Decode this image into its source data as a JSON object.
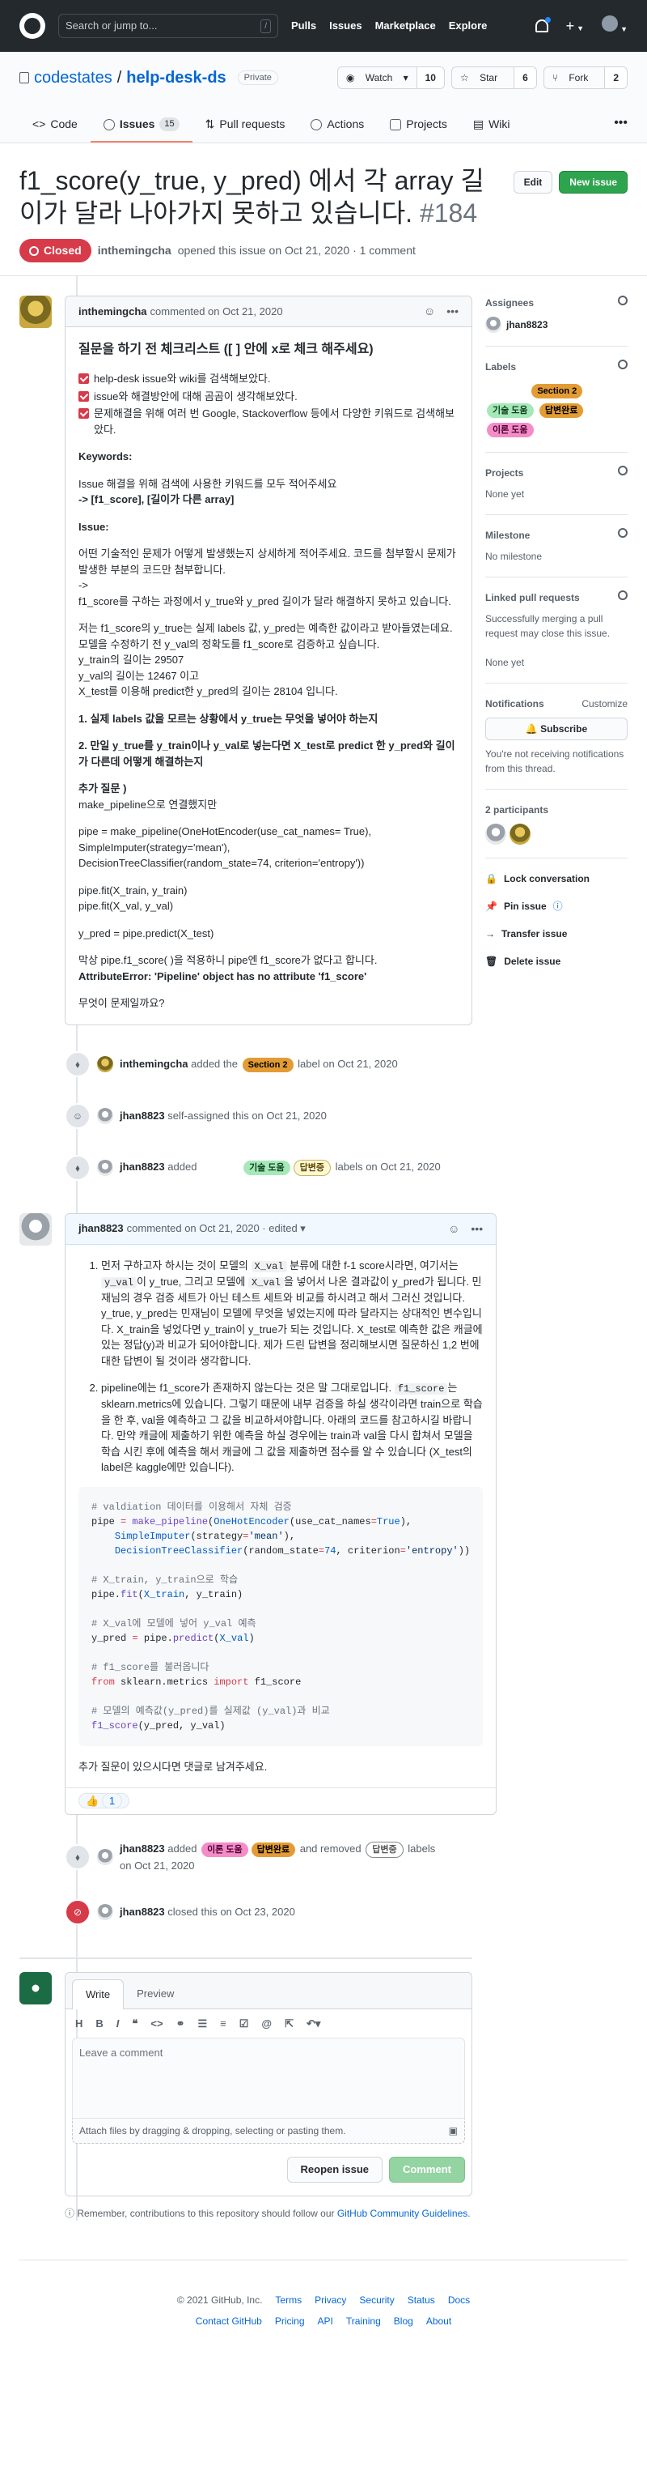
{
  "header": {
    "search_placeholder": "Search or jump to...",
    "slash": "/",
    "nav": [
      "Pulls",
      "Issues",
      "Marketplace",
      "Explore"
    ]
  },
  "repo": {
    "owner": "codestates",
    "sep": "/",
    "name": "help-desk-ds",
    "visibility": "Private",
    "watch_label": "Watch",
    "watch_count": "10",
    "star_label": "Star",
    "star_count": "6",
    "fork_label": "Fork",
    "fork_count": "2"
  },
  "tabs": [
    {
      "label": "Code"
    },
    {
      "label": "Issues",
      "count": "15"
    },
    {
      "label": "Pull requests"
    },
    {
      "label": "Actions"
    },
    {
      "label": "Projects"
    },
    {
      "label": "Wiki"
    }
  ],
  "issue": {
    "title": "f1_score(y_true, y_pred) 에서 각 array 길이가 달라 나아가지 못하고 있습니다.",
    "number": "#184",
    "edit": "Edit",
    "new_issue": "New issue",
    "state": "Closed",
    "author": "inthemingcha",
    "opened": "opened this issue on Oct 21, 2020 · 1 comment"
  },
  "first_comment": {
    "author": "inthemingcha",
    "time": "commented on Oct 21, 2020",
    "heading": "질문을 하기 전 체크리스트 ([ ] 안에 x로 체크 해주세요)",
    "checks": [
      "help-desk issue와 wiki를 검색해보았다.",
      "issue와 해결방안에 대해 곰곰이 생각해보았다.",
      "문제해결을 위해 여러 번 Google, Stackoverflow 등에서 다양한 키워드로 검색해보았다."
    ],
    "kw_title": "Keywords:",
    "kw_desc": "Issue 해결을 위해 검색에 사용한 키워드를 모두 적어주세요",
    "kw_value": "-> [f1_score], [길이가 다른 array]",
    "issue_title": "Issue:",
    "p1": "어떤 기술적인 문제가 어떻게 발생했는지 상세하게 적어주세요. 코드를 첨부할시 문제가 발생한 부분의 코드만 첨부합니다.",
    "p1b": "->",
    "p1c": "f1_score를 구하는 과정에서 y_true와 y_pred 길이가 달라 해결하지 못하고 있습니다.",
    "p2": [
      "저는 f1_score의 y_true는 실제 labels 값, y_pred는 예측한 값이라고 받아들였는데요.",
      "모델을 수정하기 전 y_val의 정확도를 f1_score로 검증하고 싶습니다.",
      "y_train의 길이는 29507",
      "y_val의 길이는 12467 이고",
      "X_test를 이용해 predict한 y_pred의 길이는 28104 입니다."
    ],
    "q1": "1. 실제 labels 값을 모르는 상황에서 y_true는 무엇을 넣어야 하는지",
    "q2": "2. 만일 y_true를 y_train이나 y_val로 넣는다면 X_test로 predict 한 y_pred와 길이가 다른데 어떻게 해결하는지",
    "extra_title": "추가 질문 )",
    "extra": "make_pipeline으로 연결했지만",
    "pipe": [
      "pipe = make_pipeline(OneHotEncoder(use_cat_names= True),",
      "SimpleImputer(strategy='mean'),",
      "DecisionTreeClassifier(random_state=74, criterion='entropy'))"
    ],
    "fit": [
      "pipe.fit(X_train, y_train)",
      "pipe.fit(X_val, y_val)"
    ],
    "pred": "y_pred = pipe.predict(X_test)",
    "err1": "막상 pipe.f1_score( )을 적용하니 pipe엔 f1_score가 없다고 합니다.",
    "err2": "AttributeError: 'Pipeline' object has no attribute 'f1_score'",
    "ask": "무엇이 문제일까요?"
  },
  "events": {
    "e1": {
      "actor": "inthemingcha",
      "pre": "added the",
      "label": "Section 2",
      "post": "label on Oct 21, 2020"
    },
    "e2": {
      "actor": "jhan8823",
      "text": "self-assigned this on Oct 21, 2020"
    },
    "e3": {
      "actor": "jhan8823",
      "pre": "added",
      "labels": [
        "",
        "기술 도움",
        "답변중"
      ],
      "post": "labels on Oct 21, 2020"
    },
    "e4": {
      "actor": "jhan8823",
      "pre": "added",
      "added": [
        "이론 도움",
        "답변완료"
      ],
      "mid": "and removed",
      "removed": "답변중",
      "post": "labels",
      "date": "on Oct 21, 2020"
    },
    "e5": {
      "actor": "jhan8823",
      "text": "closed this on Oct 23, 2020"
    }
  },
  "answer": {
    "author": "jhan8823",
    "time": "commented on Oct 21, 2020 · edited",
    "a1": {
      "t1": "먼저 구하고자 하시는 것이 모델의",
      "c1": "X_val",
      "t2": "분류에 대한 f-1 score시라면, 여기서는",
      "c2": "y_val",
      "t3": "이 y_true, 그리고 모델에",
      "c3": "X_val",
      "t4": "을 넣어서 나온 결과값이 y_pred가 됩니다. 민재님의 경우 검증 세트가 아닌 테스트 세트와 비교를 하시려고 해서 그러신 것입니다. y_true, y_pred는 민재님이 모델에 무엇을 넣었는지에 따라 달라지는 상대적인 변수입니다. X_train을 넣었다면 y_train이 y_true가 되는 것입니다. X_test로 예측한 값은 캐글에 있는 정답(y)과 비교가 되어야합니다. 제가 드린 답변을 정리해보시면 질문하신 1,2 번에 대한 답변이 될 것이라 생각합니다."
    },
    "a2": {
      "t1": "pipeline에는 f1_score가 존재하지 않는다는 것은 말 그대로입니다.",
      "c1": "f1_score",
      "t2": "는 sklearn.metrics에 있습니다. 그렇기 때문에 내부 검증을 하실 생각이라면 train으로 학습을 한 후, val을 예측하고 그 값을 비교하셔야합니다. 아래의 코드를 참고하시길 바랍니다. 만약 캐글에 제출하기 위한 예측을 하실 경우에는 train과 val을 다시 합쳐서 모델을 학습 시킨 후에 예측을 해서 캐글에 그 값을 제출하면 점수를 알 수 있습니다 (X_test의 label은 kaggle에만 있습니다)."
    },
    "code": {
      "c1": "# valdiation 데이터를 이용해서 자체 검증",
      "c2": "# X_train, y_train으로 학습",
      "c3": "# X_val에 모델에 넣어 y_val 예측",
      "c4": "# f1_score를 불러옵니다",
      "c5": "# 모델의 예측값(y_pred)를 실제값 (y_val)과 비교"
    },
    "closing": "추가 질문이 있으시다면 댓글로 남겨주세요.",
    "reaction": "1"
  },
  "write": {
    "tab_write": "Write",
    "tab_preview": "Preview",
    "placeholder": "Leave a comment",
    "attach": "Attach files by dragging & dropping, selecting or pasting them.",
    "reopen": "Reopen issue",
    "comment": "Comment",
    "notice": "Remember, contributions to this repository should follow our",
    "notice_link": "GitHub Community Guidelines",
    "notice_end": "."
  },
  "sidebar": {
    "assignees_h": "Assignees",
    "assignee": "jhan8823",
    "labels_h": "Labels",
    "labels": [
      "",
      "Section 2",
      "기술 도움",
      "답변완료",
      "이론 도움"
    ],
    "projects_h": "Projects",
    "projects": "None yet",
    "milestone_h": "Milestone",
    "milestone": "No milestone",
    "linked_h": "Linked pull requests",
    "linked_desc": "Successfully merging a pull request may close this issue.",
    "linked": "None yet",
    "notif_h": "Notifications",
    "customize": "Customize",
    "subscribe": "Subscribe",
    "notif_desc": "You're not receiving notifications from this thread.",
    "participants": "2 participants",
    "lock": "Lock conversation",
    "pin": "Pin issue",
    "transfer": "Transfer issue",
    "delete": "Delete issue"
  },
  "footer": {
    "copy": "© 2021 GitHub, Inc.",
    "row1": [
      "Terms",
      "Privacy",
      "Security",
      "Status",
      "Docs"
    ],
    "row2": [
      "Contact GitHub",
      "Pricing",
      "API",
      "Training",
      "Blog",
      "About"
    ]
  }
}
